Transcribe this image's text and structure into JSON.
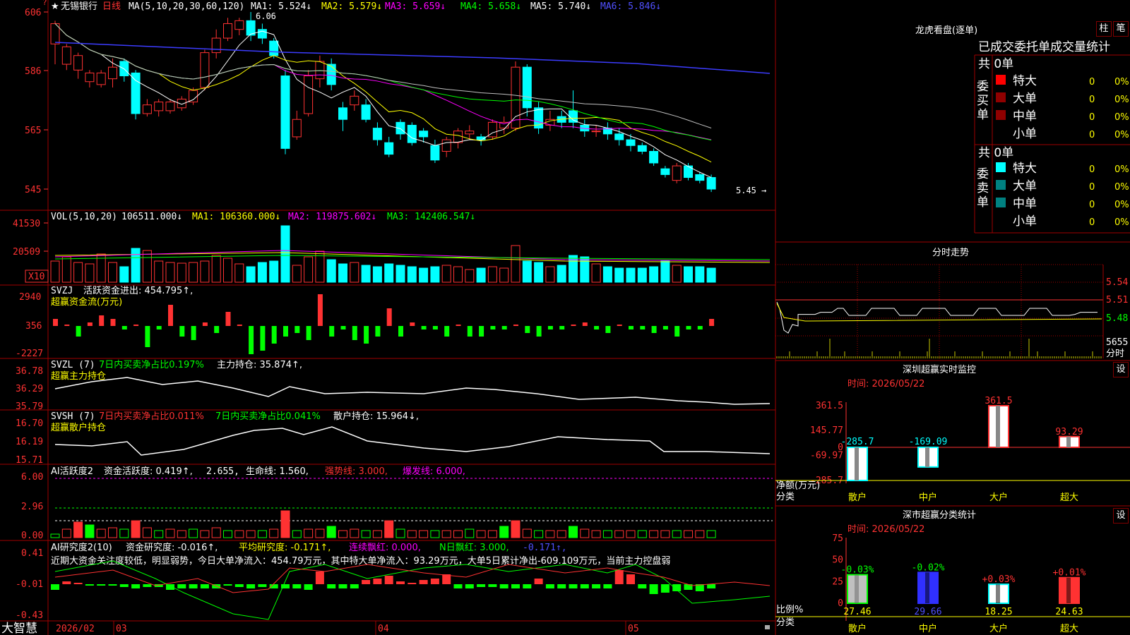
{
  "header": {
    "star": "★",
    "stock_name": "无锡银行",
    "period": "日线",
    "ma_params": "MA(5,10,20,30,60,120)",
    "ma1": "MA1: 5.524↓",
    "ma2": "MA2: 5.579↓",
    "ma3": "MA3: 5.659↓",
    "ma4": "MA4: 5.658↓",
    "ma5": "MA5: 5.740↓",
    "ma6": "MA6: 5.846↓",
    "high_mark": "6.06",
    "low_mark": "5.45"
  },
  "price_axis": [
    "606",
    "586",
    "565",
    "545"
  ],
  "volume": {
    "label": "VOL(5,10,20)",
    "value": "106511.000↓",
    "ma1": "MA1: 106360.000↓",
    "ma2": "MA2: 119875.602↓",
    "ma3": "MA3: 142406.547↓",
    "axis": [
      "41530",
      "20509"
    ],
    "unit": "X10"
  },
  "svzj": {
    "label": "SVZJ",
    "title": "活跃资金进出: 454.795↑,",
    "sub": "超赢资金流(万元)",
    "axis": [
      "2940",
      "356",
      "-2227"
    ]
  },
  "svzl": {
    "label": "SVZL (7)",
    "t1": "7日内买卖净占比0.197%",
    "t2": "主力持仓: 35.874↑,",
    "sub": "超赢主力持仓",
    "axis": [
      "36.78",
      "36.29",
      "35.79"
    ]
  },
  "svsh": {
    "label": "SVSH (7)",
    "t1": "7日内买卖净占比0.011%",
    "t2": "7日内买卖净占比0.041%",
    "t3": "散户持仓: 15.964↓,",
    "sub": "超赢散户持仓",
    "axis": [
      "16.70",
      "16.19",
      "15.71"
    ]
  },
  "ai1": {
    "label": "AI活跃度2",
    "t1": "资金活跃度: 0.419↑,",
    "t2": "2.655,",
    "t3": "生命线: 1.560,",
    "t4": "强势线: 3.000,",
    "t5": "爆发线: 6.000,",
    "axis": [
      "6.00",
      "2.96",
      "0.00"
    ]
  },
  "ai2": {
    "label": "AI研究度2(10)",
    "t1": "资金研究度: -0.016↑,",
    "t2": "平均研究度: -0.171↑,",
    "t3": "连续飘红: 0.000,",
    "t4": "N日飘红: 3.000,",
    "t5": "-0.171↑,",
    "comment": "近期大资金关注度较低，明显弱势，今日大单净流入：454.79万元，其中特大单净流入：93.29万元，大单5日累计净出-609.109万元，当前主力控盘弱",
    "axis": [
      "0.41",
      "-0.01",
      "-0.43"
    ]
  },
  "bottom": {
    "brand": "大智慧",
    "date1": "2026/02",
    "m3": "03",
    "m4": "04",
    "m5": "05"
  },
  "lhb": {
    "title": "龙虎看盘(逐单)",
    "btn1": "柱",
    "btn2": "笔",
    "subtitle": "已成交委托单成交量统计",
    "buy_label": "委买单",
    "sell_label": "委卖单",
    "buy_total": "共 0单",
    "sell_total": "共 0单",
    "rows": [
      {
        "name": "特大",
        "count": "0",
        "pct": "0%"
      },
      {
        "name": "大单",
        "count": "0",
        "pct": "0%"
      },
      {
        "name": "中单",
        "count": "0",
        "pct": "0%"
      },
      {
        "name": "小单",
        "count": "0",
        "pct": "0%"
      }
    ]
  },
  "intraday": {
    "title": "分时走势",
    "axis": [
      "5.54",
      "5.51",
      "5.48"
    ],
    "vol": "5655",
    "vol_label": "分时"
  },
  "monitor": {
    "title": "深圳超赢实时监控",
    "btn": "设",
    "time": "时间: 2026/05/22",
    "axis": [
      "361.5",
      "145.77",
      "0",
      "-69.97",
      "-285.7"
    ],
    "unit": "净额(万元)",
    "cat_label": "分类",
    "chart_data": {
      "type": "bar",
      "categories": [
        "散户",
        "中户",
        "大户",
        "超大"
      ],
      "values": [
        -285.7,
        -169.09,
        361.5,
        93.29
      ],
      "labels": [
        "-285.7",
        "-169.09",
        "361.5",
        "93.29"
      ],
      "ylim": [
        -285.7,
        361.5
      ]
    }
  },
  "classify": {
    "title": "深市超赢分类统计",
    "btn": "设",
    "time": "时间: 2026/05/22",
    "axis": [
      "75",
      "50",
      "25",
      "0"
    ],
    "unit": "比例%",
    "cat_label": "分类",
    "chart_data": {
      "type": "bar",
      "categories": [
        "散户",
        "中户",
        "大户",
        "超大"
      ],
      "values": [
        27.46,
        29.66,
        18.25,
        24.63
      ],
      "changes": [
        "-0.03%",
        "-0.02%",
        "+0.03%",
        "+0.01%"
      ],
      "ylim": [
        0,
        75
      ]
    }
  }
}
